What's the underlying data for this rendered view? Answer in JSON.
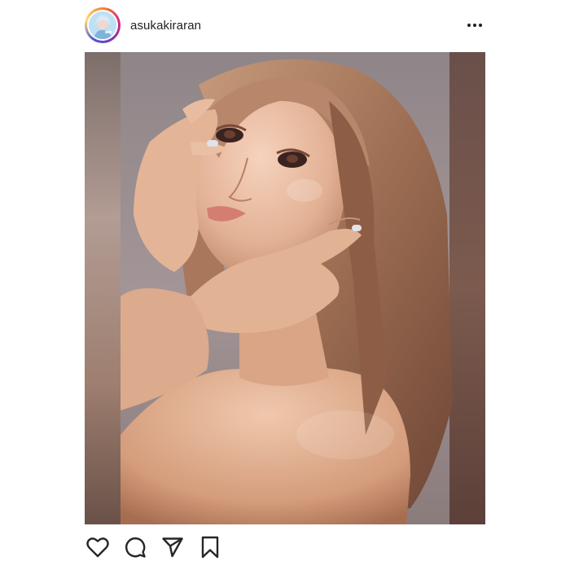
{
  "post": {
    "username": "asukakiraran",
    "header": {
      "avatar_icon": "profile-avatar",
      "more_icon": "more-horizontal-icon"
    },
    "actions": {
      "like_icon": "heart-icon",
      "comment_icon": "comment-icon",
      "share_icon": "send-icon",
      "save_icon": "bookmark-icon"
    },
    "colors": {
      "text": "#222222",
      "background": "#ffffff",
      "icon": "#262626"
    }
  }
}
